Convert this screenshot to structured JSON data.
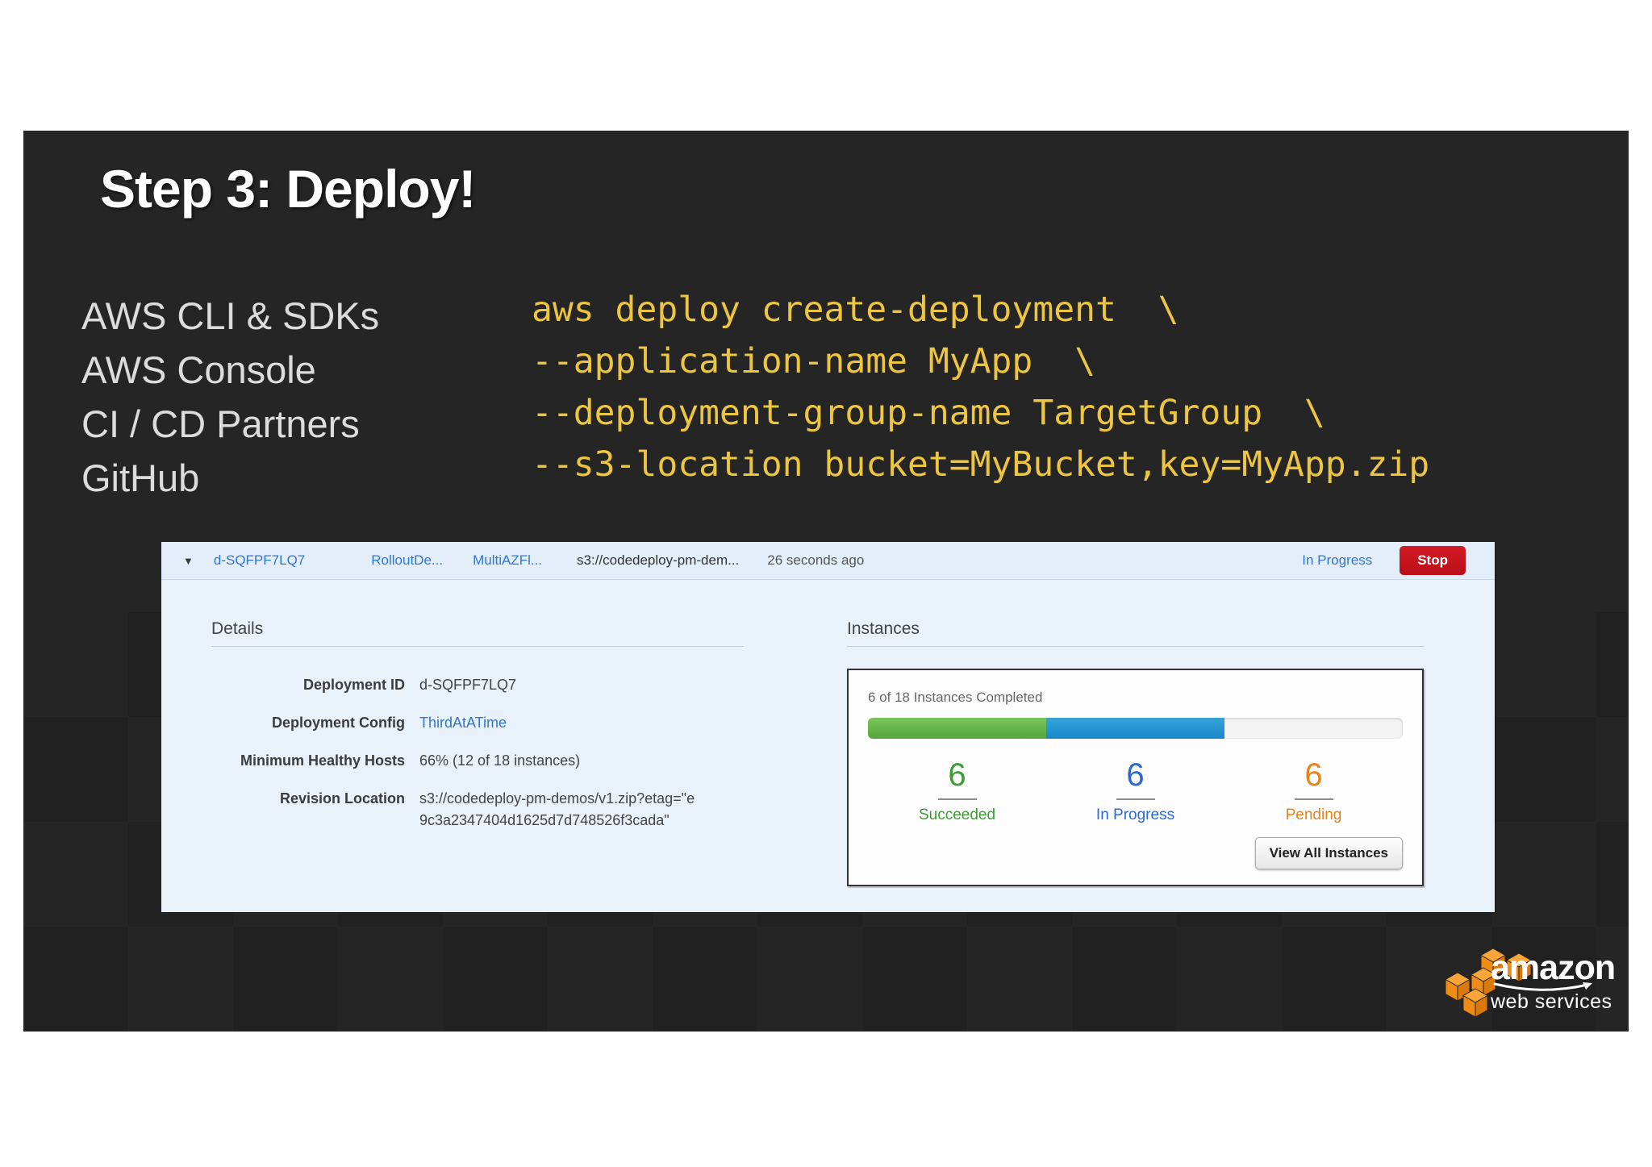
{
  "slide": {
    "title": "Step 3: Deploy!",
    "left_items": [
      "AWS CLI & SDKs",
      "AWS Console",
      "CI / CD Partners",
      "GitHub"
    ],
    "code_lines": [
      "aws deploy create-deployment  \\",
      "--application-name MyApp  \\",
      "--deployment-group-name TargetGroup  \\",
      "--s3-location bucket=MyBucket,key=MyApp.zip"
    ]
  },
  "icons": {
    "caret_down": "▼"
  },
  "console": {
    "toolbar": {
      "deployment_id": "d-SQFPF7LQ7",
      "link1": "RolloutDe...",
      "link2": "MultiAZFl...",
      "s3_path": "s3://codedeploy-pm-dem...",
      "time_ago": "26 seconds ago",
      "status": "In Progress",
      "stop_label": "Stop"
    },
    "details": {
      "heading": "Details",
      "rows": [
        {
          "label": "Deployment ID",
          "value": "d-SQFPF7LQ7"
        },
        {
          "label": "Deployment Config",
          "value": "ThirdAtATime"
        },
        {
          "label": "Minimum Healthy Hosts",
          "value": "66% (12 of 18 instances)"
        },
        {
          "label": "Revision Location",
          "value_lines": [
            "s3://codedeploy-pm-demos/v1.zip?etag=\"e",
            "9c3a2347404d1625d7d748526f3cada\""
          ]
        }
      ]
    },
    "instances": {
      "heading": "Instances",
      "completed_text": "6 of 18 Instances Completed",
      "total": 18,
      "progress": {
        "succeeded_pct": 33.33,
        "in_progress_pct": 33.33,
        "pending_pct": 33.34
      },
      "stats": [
        {
          "value": "6",
          "label": "Succeeded"
        },
        {
          "value": "6",
          "label": "In Progress"
        },
        {
          "value": "6",
          "label": "Pending"
        }
      ],
      "view_all_label": "View All Instances"
    }
  },
  "logo": {
    "amazon": "amazon",
    "web_services": "web services"
  },
  "colors": {
    "slide_bg": "#252525",
    "code_yellow": "#edc53f",
    "console_bg": "#e9f1fa",
    "link_blue": "#2e77d0",
    "stop_red": "#c6131e",
    "succeeded_green": "#3e9c35",
    "in_progress_blue": "#2a68d9",
    "pending_orange": "#e8821d",
    "bar_green": "#5fb148",
    "bar_blue": "#1b8fd1",
    "aws_orange": "#f7981f"
  }
}
